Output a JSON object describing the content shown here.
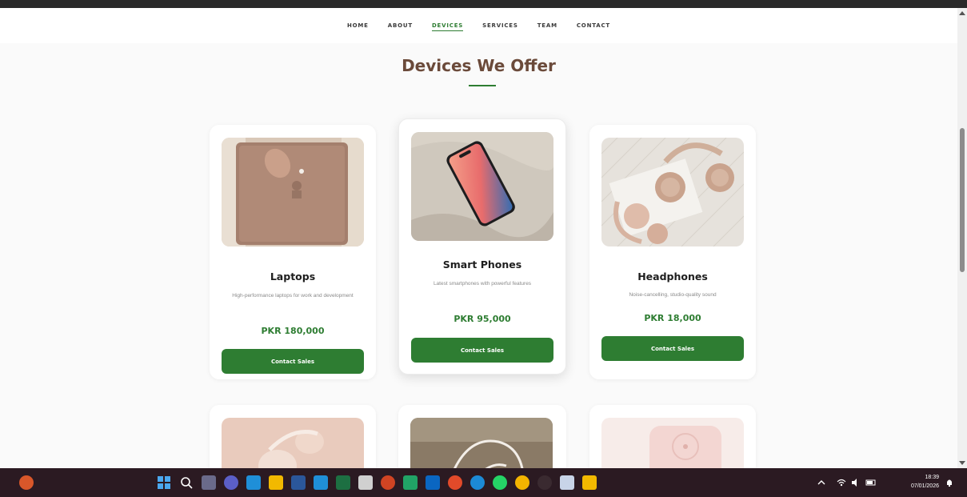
{
  "nav": {
    "items": [
      "HOME",
      "ABOUT",
      "DEVICES",
      "SERVICES",
      "TEAM",
      "CONTACT"
    ],
    "active": "DEVICES"
  },
  "section": {
    "title": "Devices We Offer"
  },
  "products": [
    {
      "name": "Laptops",
      "description": "High-performance laptops for work and development",
      "price": "PKR 180,000",
      "button": "Contact Sales"
    },
    {
      "name": "Smart Phones",
      "description": "Latest smartphones with powerful features",
      "price": "PKR 95,000",
      "button": "Contact Sales"
    },
    {
      "name": "Headphones",
      "description": "Noise-cancelling, studio-quality sound",
      "price": "PKR 18,000",
      "button": "Contact Sales"
    }
  ],
  "taskbar": {
    "time": "18:39",
    "date": "07/01/2026"
  },
  "colors": {
    "accent": "#2e7d32",
    "title": "#6b4a3a",
    "taskbar": "#2b1a22"
  }
}
